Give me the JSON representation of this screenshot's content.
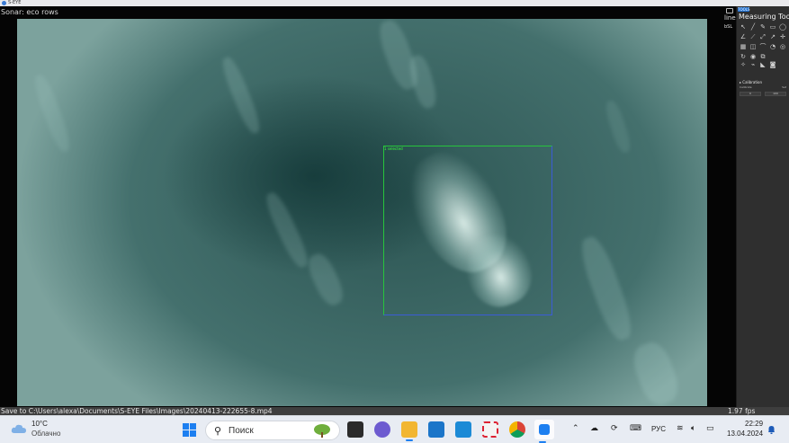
{
  "window": {
    "title": "S-EYE",
    "overlay_label": "Sonar: eco rows",
    "overlay_tools": "⊙ ⊙ ◉ ⊙"
  },
  "video": {
    "roi_label": "1 selected"
  },
  "side": {
    "right_label": "line",
    "right_label2": "bSL"
  },
  "panel": {
    "tab_label": "TOOLS",
    "title": "Measuring Tools",
    "calibration_label": "▸ Calibration",
    "calib_left": "Calibrate",
    "calib_right": "Set",
    "calib_field1": "0",
    "calib_field2": "100"
  },
  "mini": {
    "a": "Data",
    "b": "Channel"
  },
  "status": {
    "save_path": "Save to C:\\Users\\alexa\\Documents\\S-EYE Files\\Images\\20240413-222655-8.mp4",
    "fps": "1.97 fps"
  },
  "taskbar": {
    "weather_temp": "10°C",
    "weather_desc": "Облачно",
    "search_placeholder": "Поиск",
    "language": "РУС",
    "time": "22:29",
    "date": "13.04.2024"
  },
  "icons": {
    "start": "windows-start-icon",
    "search": "search-icon",
    "weather": "cloud-icon"
  },
  "colors": {
    "roi_border": "#27c43c",
    "accent": "#1d7ff0",
    "panel_bg": "#2f2f2f"
  }
}
